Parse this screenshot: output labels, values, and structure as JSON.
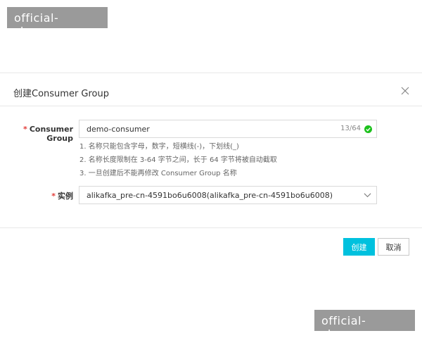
{
  "watermarks": {
    "top": "official-zlg.com",
    "bottom": "official-zlg.com"
  },
  "dialog": {
    "title": "创建Consumer Group",
    "close_icon": "close-icon"
  },
  "form": {
    "consumer_group": {
      "required_mark": "*",
      "label": "Consumer Group",
      "value": "demo-consumer",
      "counter": "13/64",
      "status_icon": "check-circle-icon",
      "hints": [
        "1. 名称只能包含字母，数字，短横线(-)，下划线(_)",
        "2. 名称长度限制在 3-64 字节之间，长于 64 字节将被自动截取",
        "3. 一旦创建后不能再修改 Consumer Group 名称"
      ]
    },
    "instance": {
      "required_mark": "*",
      "label": "实例",
      "value": "alikafka_pre-cn-4591bo6u6008(alikafka_pre-cn-4591bo6u6008)",
      "dropdown_icon": "chevron-down-icon"
    }
  },
  "footer": {
    "create_label": "创建",
    "cancel_label": "取消"
  },
  "colors": {
    "primary": "#00c1de",
    "success": "#1dc11d",
    "required": "#e23c39"
  }
}
